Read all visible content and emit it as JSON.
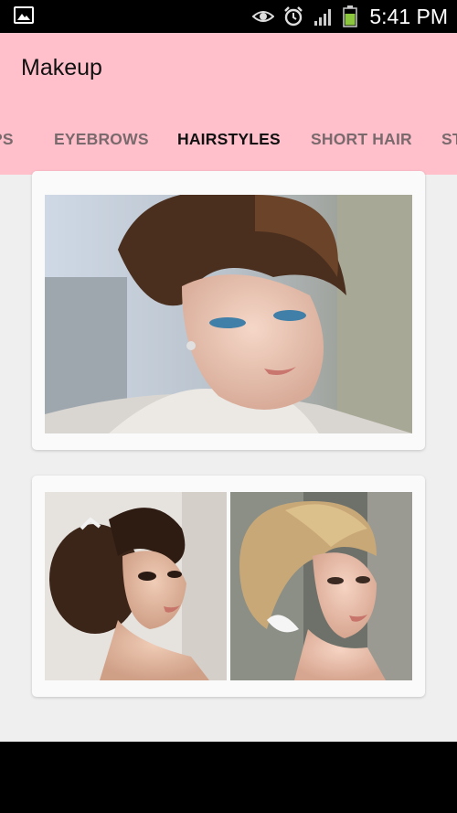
{
  "status_bar": {
    "time": "5:41 PM",
    "icons": [
      "gallery-notification-icon",
      "eye-icon",
      "alarm-icon",
      "signal-icon",
      "battery-icon"
    ]
  },
  "app_bar": {
    "title": "Makeup",
    "background": "#ffc0cb"
  },
  "tabs": [
    {
      "label": "LIPS",
      "visible_text": "IPS",
      "active": false
    },
    {
      "label": "EYEBROWS",
      "active": false
    },
    {
      "label": "HAIRSTYLES",
      "active": true
    },
    {
      "label": "SHORT HAIR",
      "active": false
    },
    {
      "label": "ST",
      "active": false
    }
  ],
  "cards": [
    {
      "images": [
        "hairstyle-photo-updo-brunette"
      ]
    },
    {
      "images": [
        "hairstyle-photo-curly-updo-brunette",
        "hairstyle-photo-blonde-updo"
      ]
    }
  ]
}
